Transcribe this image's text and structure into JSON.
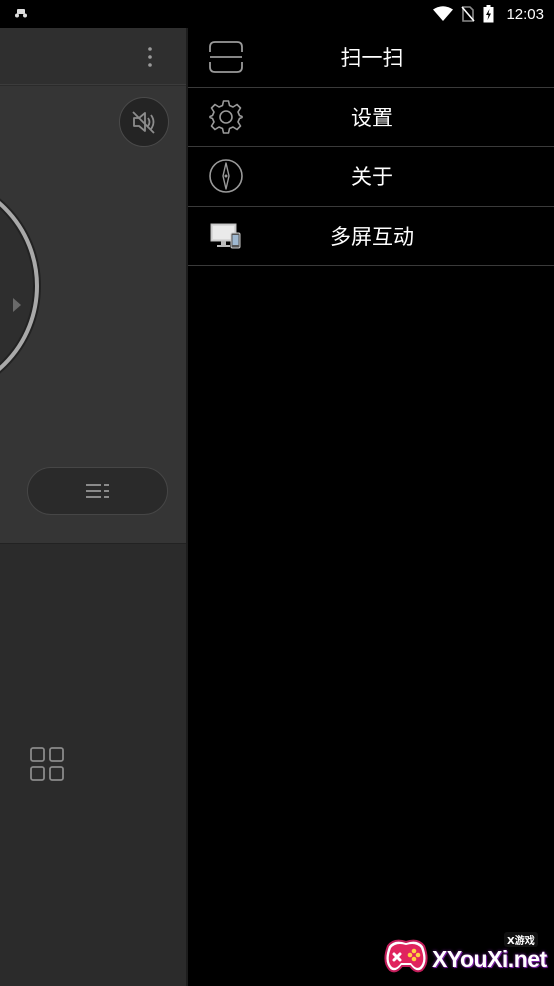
{
  "status_bar": {
    "time": "12:03",
    "icons": [
      "notification-app-icon",
      "wifi-icon",
      "no-sim-icon",
      "battery-charging-icon"
    ]
  },
  "background_app": {
    "icons": [
      "overflow-menu-icon",
      "mute-icon",
      "menu-list-icon",
      "grid-icon"
    ]
  },
  "drawer": {
    "items": [
      {
        "label": "扫一扫",
        "icon": "scan-icon"
      },
      {
        "label": "设置",
        "icon": "settings-gear-icon"
      },
      {
        "label": "关于",
        "icon": "compass-icon"
      },
      {
        "label": "多屏互动",
        "icon": "multi-screen-icon"
      }
    ]
  },
  "watermark": {
    "text": "XYouXi.net",
    "tag": "X游戏"
  },
  "colors": {
    "drawer_bg": "#000000",
    "app_bg": "#2b2b2b",
    "divider": "#3a3a3a",
    "text": "#ffffff",
    "watermark_accent": "#e0245e"
  }
}
